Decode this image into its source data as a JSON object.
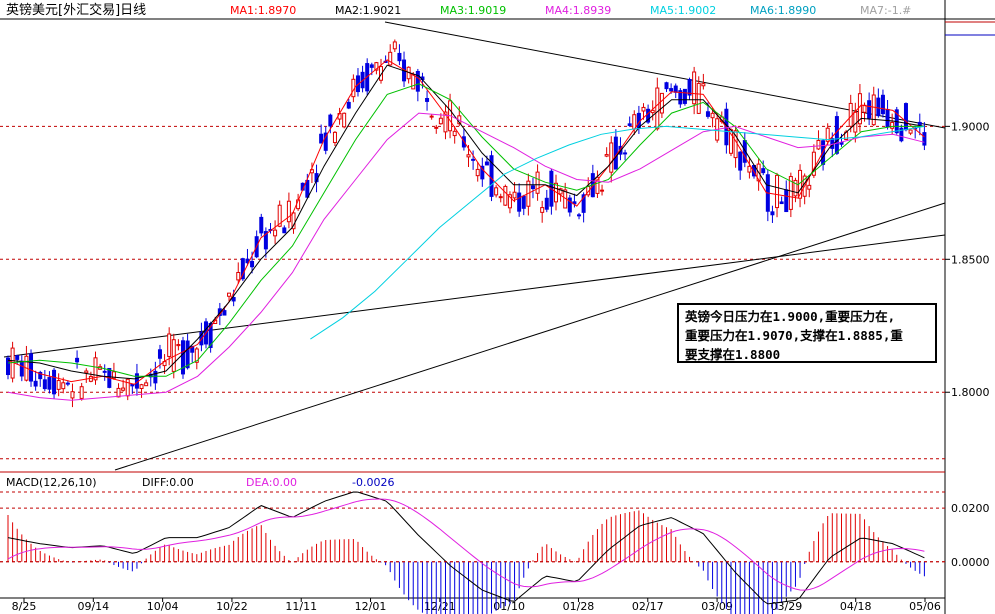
{
  "header": {
    "title": "英镑美元[外汇交易]日线",
    "ma_labels": [
      {
        "text": "MA1:1.8970",
        "color": "#ff0000"
      },
      {
        "text": "MA2:1.9021",
        "color": "#000000"
      },
      {
        "text": "MA3:1.9019",
        "color": "#00c000"
      },
      {
        "text": "MA4:1.8939",
        "color": "#e020e0"
      },
      {
        "text": "MA5:1.9002",
        "color": "#00d0e0"
      },
      {
        "text": "MA6:1.8990",
        "color": "#00a0c0"
      },
      {
        "text": "MA7:-1.#",
        "color": "#a0a0a0"
      }
    ]
  },
  "macd_header": {
    "name": "MACD(12,26,10)",
    "diff": "DIFF:0.00",
    "dea": "DEA:0.00",
    "macd": "-0.0026"
  },
  "annotation": {
    "lines": [
      "英镑今日压力在1.9000,重要压力在,",
      "重要压力在1.9070,支撑在1.8885,重",
      "要支撑在1.8800"
    ]
  },
  "colors": {
    "up": "#e00000",
    "down": "#0000e0",
    "ma1": "#ff0000",
    "ma2": "#000000",
    "ma3": "#00c000",
    "ma4": "#e020e0",
    "ma5": "#00d0e0"
  },
  "chart_data": {
    "type": "line",
    "price_axis": {
      "ticks": [
        "1.9000",
        "1.8500",
        "1.8000"
      ]
    },
    "macd_axis": {
      "ticks": [
        "0.0200",
        "0.0000"
      ]
    },
    "x_labels": [
      "8/25",
      "09/14",
      "10/04",
      "10/22",
      "11/11",
      "12/01",
      "12/21",
      "01/10",
      "01/28",
      "02/17",
      "03/09",
      "03/29",
      "04/18",
      "05/06"
    ],
    "series": [
      {
        "name": "MA1",
        "values": [
          1.812,
          1.807,
          1.804,
          1.806,
          1.803,
          1.812,
          1.818,
          1.834,
          1.858,
          1.867,
          1.895,
          1.915,
          1.925,
          1.918,
          1.902,
          1.884,
          1.872,
          1.878,
          1.87,
          1.885,
          1.902,
          1.913,
          1.912,
          1.895,
          1.875,
          1.873,
          1.895,
          1.908,
          1.906,
          1.896
        ]
      },
      {
        "name": "MA2",
        "values": [
          1.812,
          1.811,
          1.808,
          1.806,
          1.805,
          1.808,
          1.82,
          1.834,
          1.85,
          1.862,
          1.885,
          1.905,
          1.923,
          1.919,
          1.906,
          1.89,
          1.878,
          1.878,
          1.874,
          1.885,
          1.9,
          1.91,
          1.91,
          1.897,
          1.878,
          1.875,
          1.892,
          1.903,
          1.902,
          1.9
        ]
      },
      {
        "name": "MA3",
        "values": [
          1.811,
          1.812,
          1.811,
          1.809,
          1.806,
          1.806,
          1.812,
          1.826,
          1.842,
          1.855,
          1.875,
          1.895,
          1.912,
          1.916,
          1.91,
          1.896,
          1.884,
          1.879,
          1.876,
          1.88,
          1.893,
          1.905,
          1.909,
          1.9,
          1.884,
          1.878,
          1.888,
          1.898,
          1.9,
          1.9
        ]
      },
      {
        "name": "MA4",
        "values": [
          1.8,
          1.798,
          1.797,
          1.798,
          1.799,
          1.8,
          1.806,
          1.817,
          1.83,
          1.845,
          1.865,
          1.88,
          1.895,
          1.905,
          1.904,
          1.898,
          1.892,
          1.885,
          1.88,
          1.879,
          1.884,
          1.891,
          1.898,
          1.9,
          1.896,
          1.892,
          1.893,
          1.896,
          1.897,
          1.894
        ]
      },
      {
        "name": "MA5",
        "values": [
          1.82,
          1.828,
          1.838,
          1.85,
          1.862,
          1.872,
          1.882,
          1.888,
          1.893,
          1.897,
          1.899,
          1.9,
          1.899,
          1.898,
          1.897,
          1.896,
          1.895,
          1.896,
          1.898,
          1.9
        ]
      }
    ],
    "price_range": [
      1.77,
      1.94
    ],
    "macd_range": [
      -0.012,
      0.026
    ]
  }
}
